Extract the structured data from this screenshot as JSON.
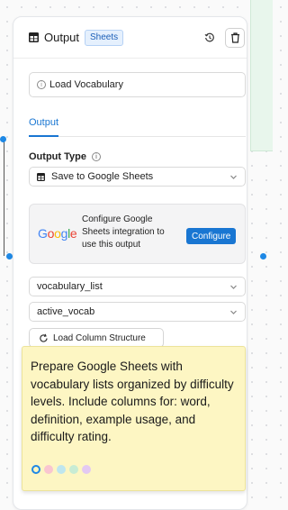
{
  "node": {
    "title": "Output",
    "badge": "Sheets",
    "name_field": {
      "value": "Load Vocabulary"
    },
    "tabs": [
      {
        "label": "Output"
      }
    ],
    "output_type": {
      "label": "Output Type",
      "selected": "Save to Google Sheets"
    },
    "google_integration": {
      "logo_text": "Google",
      "message": "Configure Google Sheets integration to use this output",
      "button_label": "Configure"
    },
    "sheet_select": {
      "selected": "vocabulary_list"
    },
    "tab_select": {
      "selected": "active_vocab"
    },
    "load_button_label": "Load Column Structure"
  },
  "sticky_note": {
    "text": "Prepare Google Sheets with vocabulary lists organized by difficulty levels. Include columns for: word, definition, example usage, and difficulty rating.",
    "color_options": [
      "#fdf6c3",
      "#f9c6d0",
      "#bfe6ee",
      "#c8ecd4",
      "#e3c9f2"
    ],
    "selected_color_index": 0
  },
  "colors": {
    "accent": "#1976d2",
    "note_bg": "#fdf6c3",
    "canvas_dots": "#d4d6da",
    "green_panel": "#e8f6ec"
  },
  "icons": {
    "header": "grid-table-icon",
    "history": "history-icon",
    "delete": "trash-icon",
    "info": "info-icon",
    "sheets": "grid-table-icon",
    "chevron": "chevron-down-icon",
    "refresh": "refresh-icon"
  }
}
